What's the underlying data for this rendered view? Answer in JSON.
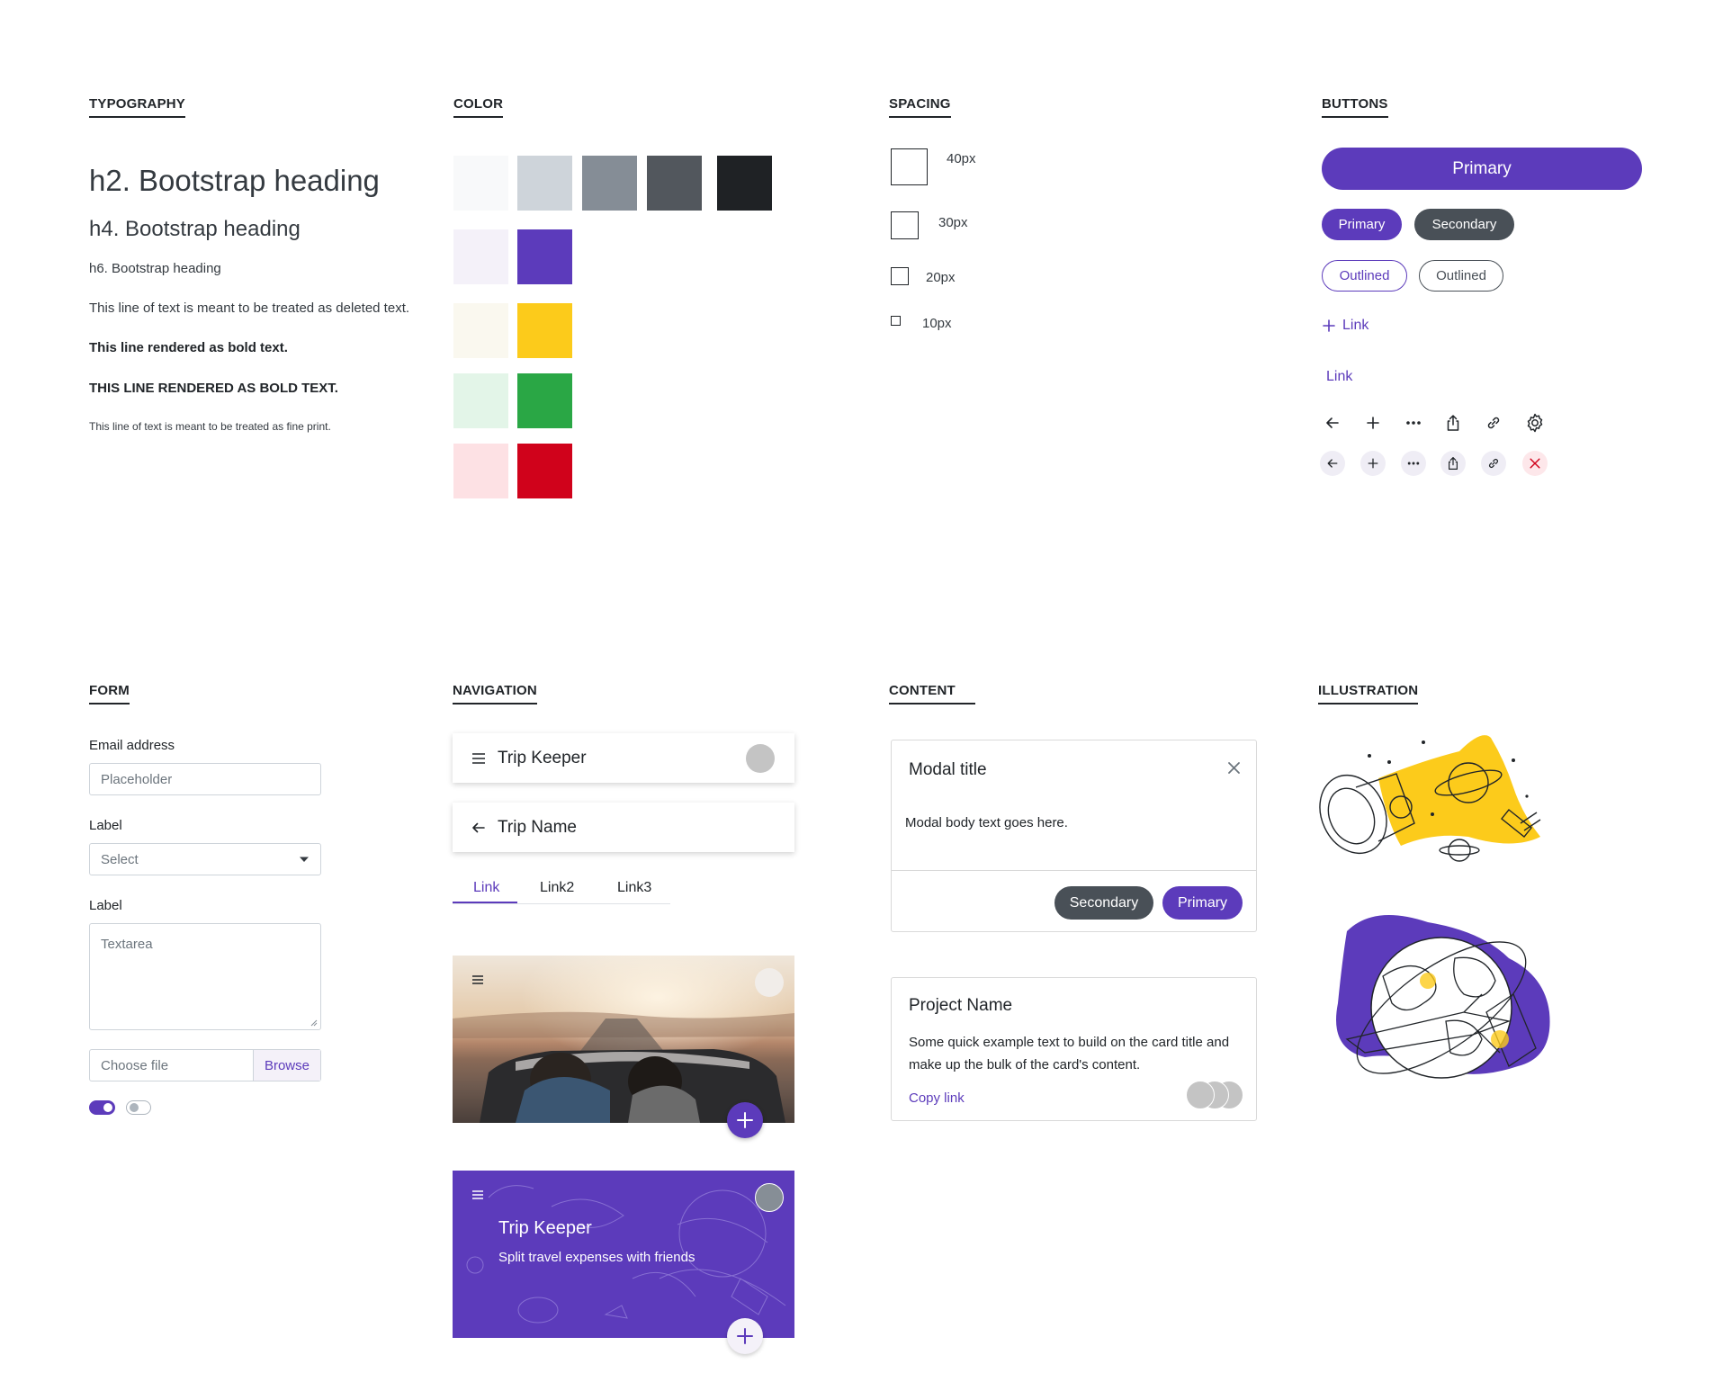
{
  "sections": {
    "typography": "TYPOGRAPHY",
    "color": "COLOR",
    "spacing": "SPACING",
    "buttons": "BUTTONS",
    "form": "FORM",
    "navigation": "NAVIGATION",
    "content": "CONTENT",
    "illustration": "ILLUSTRATION"
  },
  "typography": {
    "h2": "h2. Bootstrap heading",
    "h4": "h4. Bootstrap heading",
    "h6": "h6. Bootstrap heading",
    "deleted": "This line of text is meant to be treated as deleted text.",
    "bold": "This line rendered as bold text.",
    "bold_caps": "THIS LINE RENDERED AS BOLD TEXT.",
    "fine": "This line of text is meant to be treated as fine print."
  },
  "colors": {
    "grays": [
      "#f8f9fa",
      "#ced4da",
      "#858d96",
      "#52575d",
      "#1f2225"
    ],
    "purple": [
      "#f4f1f9",
      "#5c3bbb"
    ],
    "yellow": [
      "#faf8ef",
      "#fccb1b"
    ],
    "green": [
      "#e3f5e8",
      "#2aa745"
    ],
    "red": [
      "#fde1e4",
      "#d0021b"
    ]
  },
  "spacing": {
    "s40": "40px",
    "s30": "30px",
    "s20": "20px",
    "s10": "10px"
  },
  "buttons": {
    "primary_large": "Primary",
    "primary": "Primary",
    "secondary": "Secondary",
    "outlined_primary": "Outlined",
    "outlined_secondary": "Outlined",
    "link_with_icon": "Link",
    "link": "Link",
    "icons_row1": [
      "arrow-left-icon",
      "plus-icon",
      "more-icon",
      "share-icon",
      "link-icon",
      "gear-icon"
    ],
    "icons_row2": [
      "arrow-left-icon",
      "plus-icon",
      "more-icon",
      "share-icon",
      "link-icon",
      "close-icon"
    ]
  },
  "form": {
    "email_label": "Email address",
    "email_placeholder": "Placeholder",
    "select_label": "Label",
    "select_value": "Select",
    "textarea_label": "Label",
    "textarea_placeholder": "Textarea",
    "file_placeholder": "Choose file",
    "file_button": "Browse",
    "toggle_on": true,
    "toggle_off": false
  },
  "navigation": {
    "nav1_title": "Trip Keeper",
    "nav2_title": "Trip Name",
    "tabs": [
      "Link",
      "Link2",
      "Link3"
    ],
    "hero_title": "Trip Keeper",
    "hero_subtitle": "Split travel expenses with friends"
  },
  "content": {
    "modal_title": "Modal title",
    "modal_body": "Modal body text goes here.",
    "modal_secondary": "Secondary",
    "modal_primary": "Primary",
    "card_title": "Project Name",
    "card_text": "Some quick example text to build on the card title and make up the bulk of the card's content.",
    "card_link": "Copy link"
  },
  "accent": "#5c3bbb"
}
